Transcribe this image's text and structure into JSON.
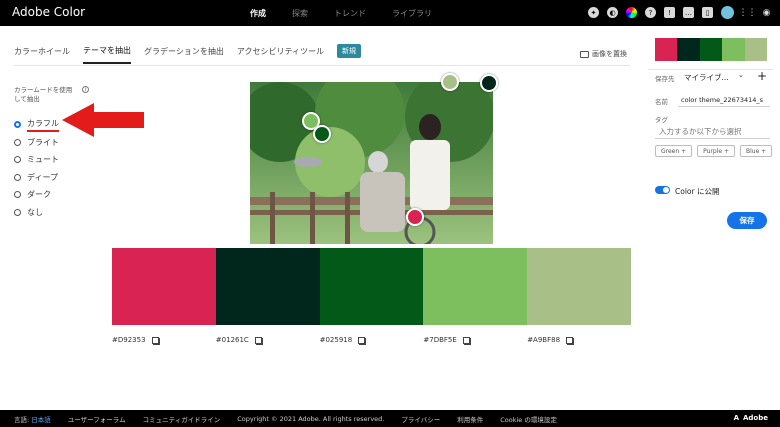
{
  "header": {
    "brand": "Adobe Color",
    "nav": [
      {
        "label": "作成",
        "active": true
      },
      {
        "label": "探索",
        "active": false
      },
      {
        "label": "トレンド",
        "active": false
      },
      {
        "label": "ライブラリ",
        "active": false
      }
    ]
  },
  "tabs": {
    "items": [
      "カラーホイール",
      "テーマを抽出",
      "グラデーションを抽出",
      "アクセシビリティツール"
    ],
    "active_index": 1,
    "new_badge": "新規",
    "replace_image": "画像を置換"
  },
  "mood": {
    "title": "カラームードを使用して抽出",
    "info_icon": "i",
    "options": [
      "カラフル",
      "ブライト",
      "ミュート",
      "ディープ",
      "ダーク",
      "なし"
    ],
    "selected_index": 0
  },
  "palette": {
    "colors": [
      "#D92353",
      "#01261C",
      "#025918",
      "#7DBF5E",
      "#A9BF88"
    ],
    "hex_labels": [
      "#D92353",
      "#01261C",
      "#025918",
      "#7DBF5E",
      "#A9BF88"
    ]
  },
  "panel": {
    "save_to_label": "保存先",
    "save_to_value": "マイライブ...",
    "name_label": "名前",
    "name_value": "color theme_22673414_s",
    "tag_label": "タグ",
    "tag_placeholder": "入力するか以下から選択",
    "tags": [
      "Green +",
      "Purple +",
      "Blue +"
    ],
    "publish_label": "Color に公開",
    "publish_on": true,
    "save_button": "保存"
  },
  "footer": {
    "language_label": "言語:",
    "language_value": "日本語",
    "links": [
      "ユーザーフォーラム",
      "コミュニティガイドライン",
      "Copyright © 2021 Adobe. All rights reserved.",
      "プライバシー",
      "利用条件",
      "Cookie の環境設定"
    ],
    "brand": "Adobe"
  },
  "accent_colors": {
    "primary_blue": "#1473e6",
    "annotation_red": "#e41b1b",
    "badge_teal": "#2d8a9e"
  }
}
